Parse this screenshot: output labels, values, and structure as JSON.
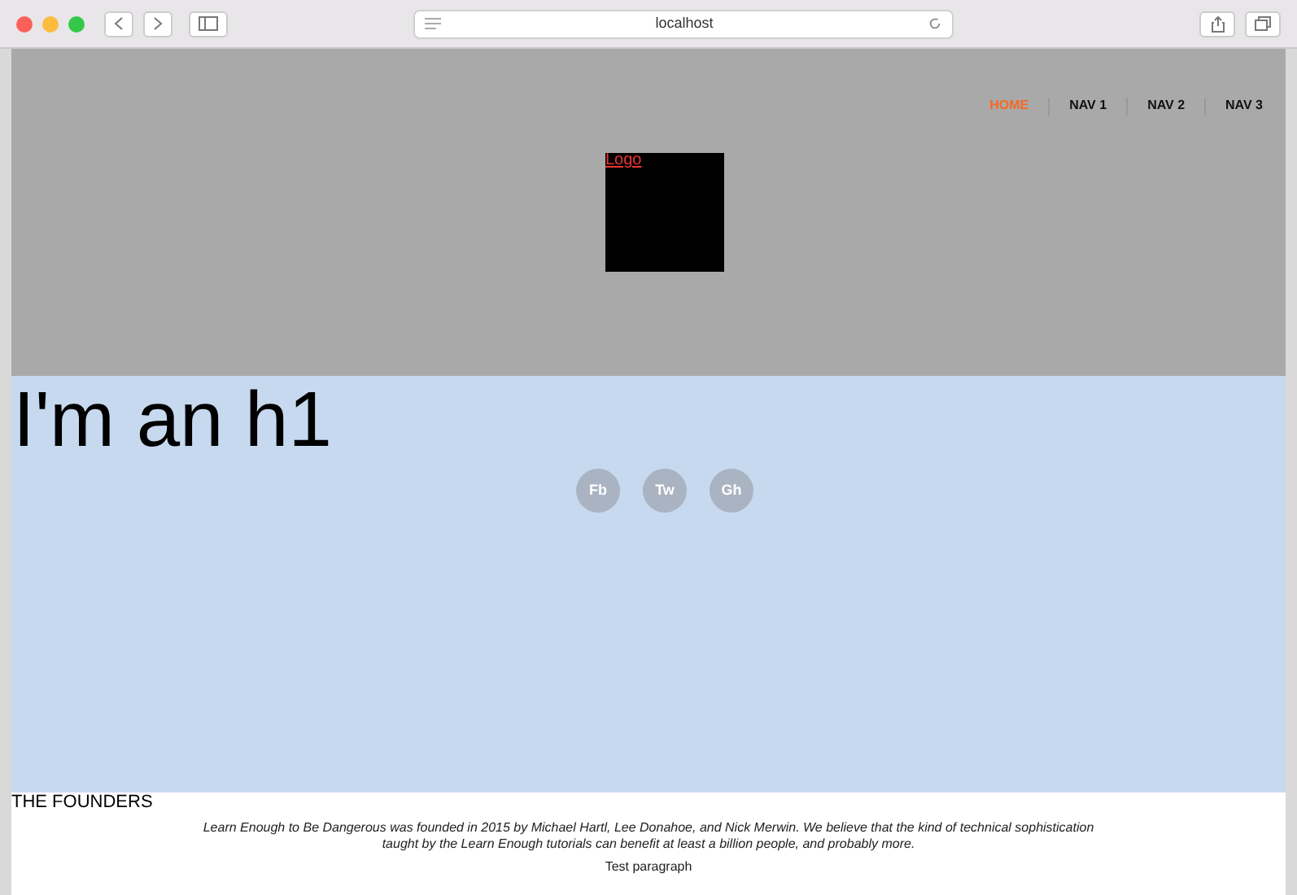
{
  "browser": {
    "address": "localhost"
  },
  "nav": [
    {
      "label": "HOME",
      "selected": true
    },
    {
      "label": "NAV 1",
      "selected": false
    },
    {
      "label": "NAV 2",
      "selected": false
    },
    {
      "label": "NAV 3",
      "selected": false
    }
  ],
  "logo": "Logo",
  "hero": {
    "heading": "I'm an h1",
    "social": [
      "Fb",
      "Tw",
      "Gh"
    ]
  },
  "founders": {
    "title": "THE FOUNDERS",
    "text": "Learn Enough to Be Dangerous was founded in 2015 by Michael Hartl, Lee Donahoe, and Nick Merwin. We believe that the kind of technical sophistication taught by the Learn Enough tutorials can benefit at least a billion people, and probably more.",
    "paragraph": "Test paragraph"
  }
}
